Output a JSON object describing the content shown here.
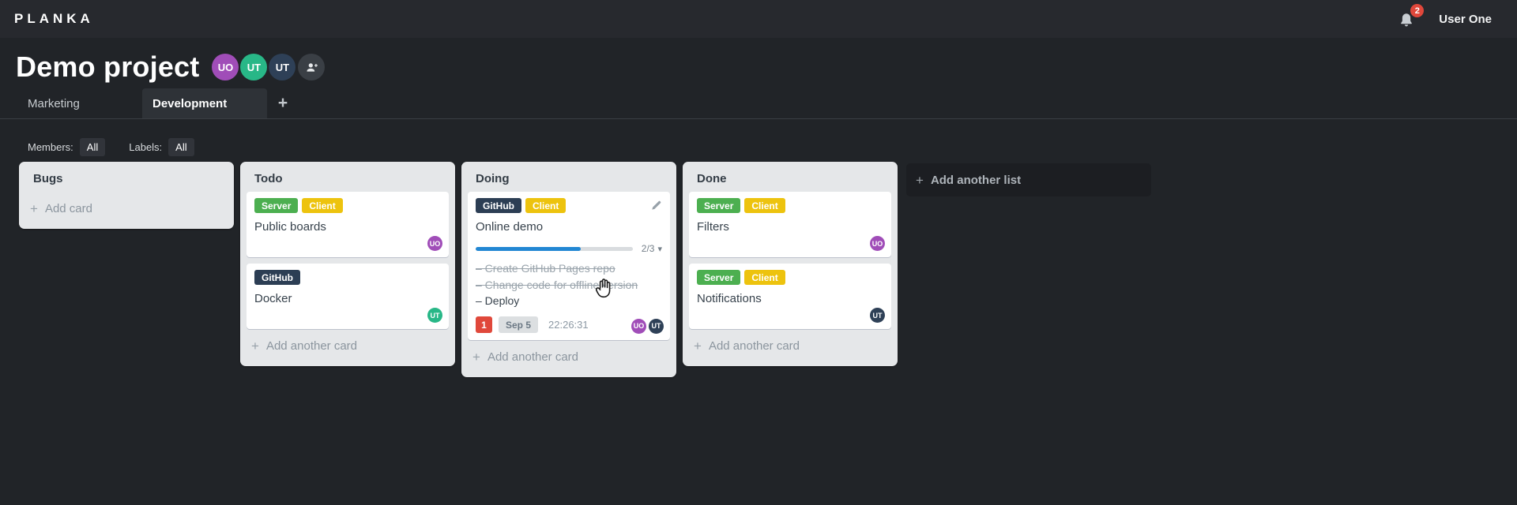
{
  "topbar": {
    "logo": "PLANKA",
    "user_name": "User One",
    "notification_count": "2"
  },
  "project": {
    "title": "Demo project"
  },
  "members": [
    {
      "initials": "UO",
      "color": "#a04db8"
    },
    {
      "initials": "UT",
      "color": "#28b787"
    },
    {
      "initials": "UT",
      "color": "#2e4057"
    }
  ],
  "tabs": {
    "items": [
      {
        "label": "Marketing",
        "active": false
      },
      {
        "label": "Development",
        "active": true
      }
    ],
    "add_label": "+"
  },
  "filters": {
    "members_label": "Members:",
    "members_value": "All",
    "labels_label": "Labels:",
    "labels_value": "All"
  },
  "label_colors": {
    "Server": "#4caf50",
    "Client": "#edc30e",
    "GitHub": "#2c3e54"
  },
  "board": {
    "add_list_label": "Add another list",
    "lists": [
      {
        "title": "Bugs",
        "add_label": "Add card",
        "cards": []
      },
      {
        "title": "Todo",
        "add_label": "Add another card",
        "cards": [
          {
            "title": "Public boards",
            "labels": [
              "Server",
              "Client"
            ],
            "members": [
              {
                "initials": "UO",
                "color": "#a04db8"
              }
            ]
          },
          {
            "title": "Docker",
            "labels": [
              "GitHub"
            ],
            "members": [
              {
                "initials": "UT",
                "color": "#28b787"
              }
            ]
          }
        ]
      },
      {
        "title": "Doing",
        "add_label": "Add another card",
        "cards": [
          {
            "title": "Online demo",
            "labels": [
              "GitHub",
              "Client"
            ],
            "editable": true,
            "checklist": {
              "progress_label": "2/3",
              "percent": 66.7,
              "items": [
                {
                  "text": "Create GitHub Pages repo",
                  "done": true
                },
                {
                  "text": "Change code for offline version",
                  "done": true
                },
                {
                  "text": "Deploy",
                  "done": false
                }
              ]
            },
            "due_count": "1",
            "due_date": "Sep 5",
            "timer": "22:26:31",
            "members": [
              {
                "initials": "UO",
                "color": "#a04db8"
              },
              {
                "initials": "UT",
                "color": "#2e4057"
              }
            ]
          }
        ]
      },
      {
        "title": "Done",
        "add_label": "Add another card",
        "cards": [
          {
            "title": "Filters",
            "labels": [
              "Server",
              "Client"
            ],
            "members": [
              {
                "initials": "UO",
                "color": "#a04db8"
              }
            ]
          },
          {
            "title": "Notifications",
            "labels": [
              "Server",
              "Client"
            ],
            "members": [
              {
                "initials": "UT",
                "color": "#2e4057"
              }
            ]
          }
        ]
      }
    ]
  }
}
